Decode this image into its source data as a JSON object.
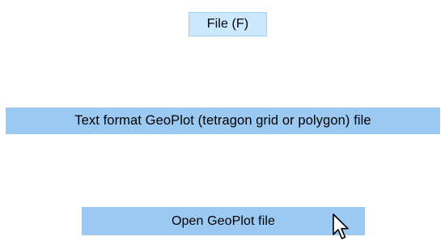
{
  "menu": {
    "file_label": "File (F)",
    "submenu_item_label": "Text format GeoPlot (tetragon grid or polygon) file",
    "open_label": "Open GeoPlot file"
  },
  "icons": {
    "cursor": "mouse-pointer-icon"
  },
  "colors": {
    "menu_hover_background": "#cce8ff",
    "menu_hover_border": "#99d1ff",
    "highlight_background": "#9cc9f2"
  }
}
